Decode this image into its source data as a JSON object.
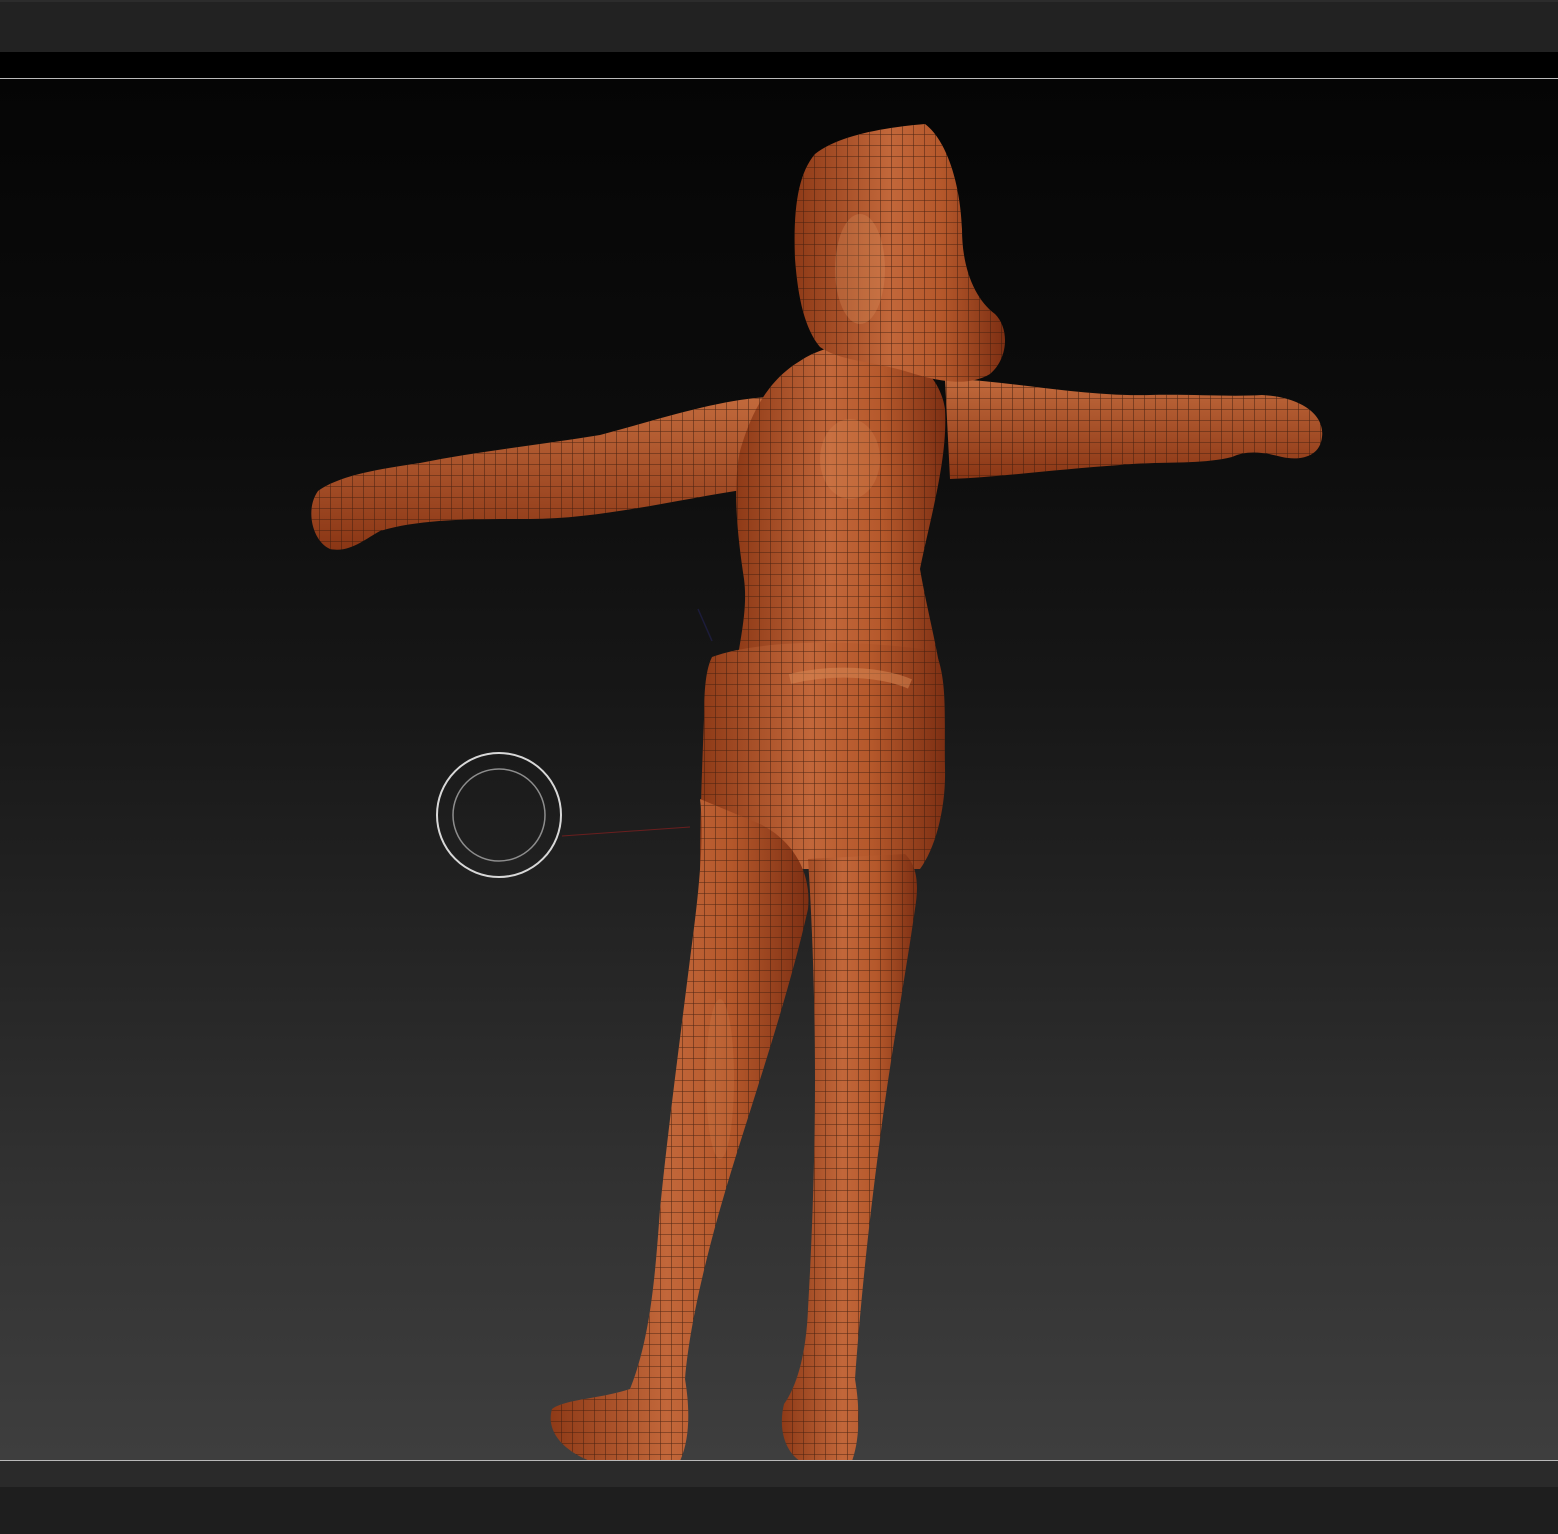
{
  "app": {
    "name": "sculpting-viewport"
  },
  "viewport": {
    "background_top": "#050505",
    "background_bottom": "#3e3e3e",
    "frame_line_color": "#b9b9b9"
  },
  "model": {
    "skin_color": "#b35426",
    "skin_highlight": "#cf7a45",
    "skin_shadow": "#7a2e12",
    "wire_color": "#3a1a0c"
  },
  "brush_cursor": {
    "ring_color": "#d8d8d8",
    "icon": "brush-cursor-icon"
  }
}
